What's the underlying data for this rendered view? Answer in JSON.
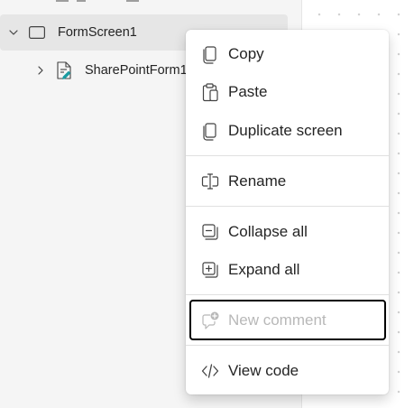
{
  "tree": {
    "screen": {
      "label": "FormScreen1"
    },
    "form": {
      "label": "SharePointForm1"
    }
  },
  "context_menu": {
    "items": [
      {
        "label": "Copy",
        "icon": "copy-icon",
        "disabled": false
      },
      {
        "label": "Paste",
        "icon": "paste-icon",
        "disabled": false
      },
      {
        "label": "Duplicate screen",
        "icon": "duplicate-icon",
        "disabled": false
      },
      {
        "label": "Rename",
        "icon": "rename-icon",
        "disabled": false
      },
      {
        "label": "Collapse all",
        "icon": "collapse-all-icon",
        "disabled": false
      },
      {
        "label": "Expand all",
        "icon": "expand-all-icon",
        "disabled": false
      },
      {
        "label": "New comment",
        "icon": "new-comment-icon",
        "disabled": true,
        "focused": true
      },
      {
        "label": "View code",
        "icon": "code-icon",
        "disabled": false
      }
    ]
  },
  "colors": {
    "pane_background": "#f5f5f5",
    "selected_row": "#e6e6e6",
    "text": "#242424",
    "disabled_text": "#b8b8b8",
    "form_icon_accent": "#1a9ba1",
    "focus_outline": "#000000"
  }
}
